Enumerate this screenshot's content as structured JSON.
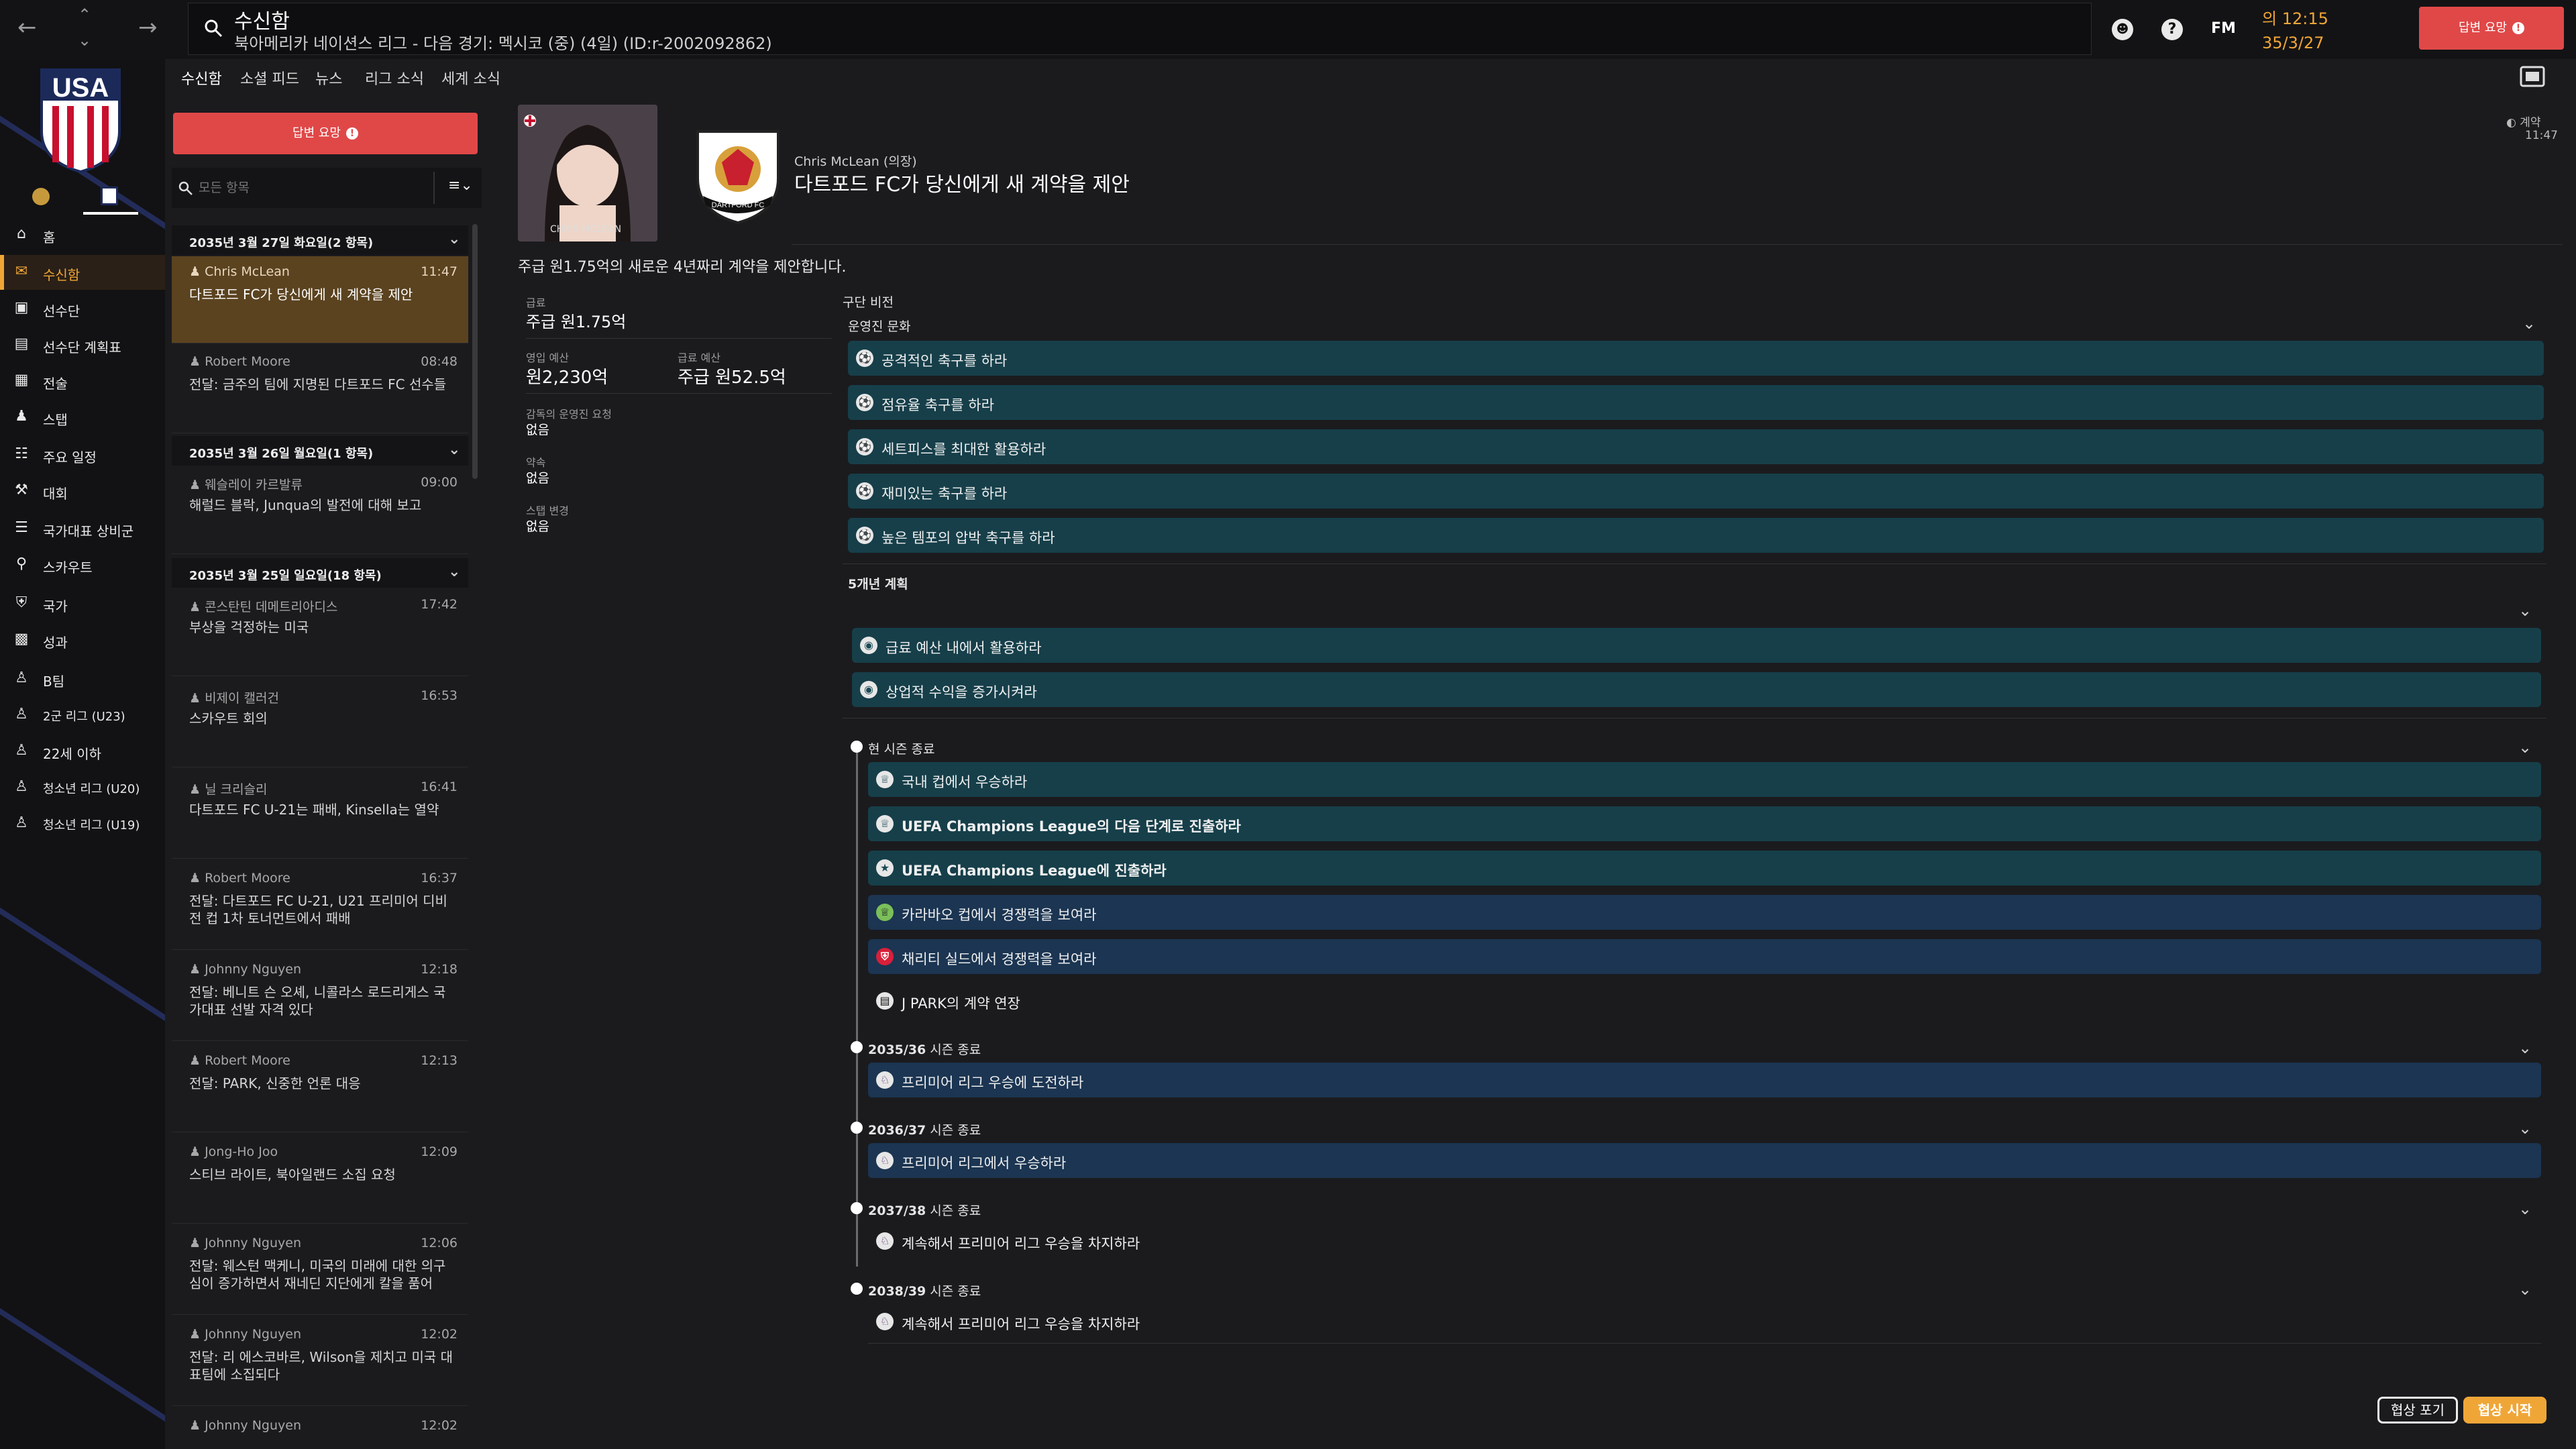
{
  "topbar": {
    "title": "수신함",
    "subtitle": "북아메리카 네이션스 리그 - 다음 경기: 멕시코 (중) (4일) (ID:r-2002092862)",
    "fm_label": "FM",
    "time": "의 12:15",
    "date": "35/3/27",
    "action_label": "답변 요망"
  },
  "left_nav": {
    "logo_text": "USA",
    "items": [
      {
        "label": "홈",
        "icon": "home-icon"
      },
      {
        "label": "수신함",
        "icon": "inbox-icon"
      },
      {
        "label": "선수단",
        "icon": "shirt-icon"
      },
      {
        "label": "선수단 계획표",
        "icon": "clipboard-icon"
      },
      {
        "label": "전술",
        "icon": "tactics-board-icon"
      },
      {
        "label": "스탭",
        "icon": "staff-icon"
      },
      {
        "label": "주요 일정",
        "icon": "calendar-icon"
      },
      {
        "label": "대회",
        "icon": "trophy-icon"
      },
      {
        "label": "국가대표 상비군",
        "icon": "list-icon"
      },
      {
        "label": "스카우트",
        "icon": "magnifier-icon"
      },
      {
        "label": "국가",
        "icon": "shield-icon"
      },
      {
        "label": "성과",
        "icon": "briefcase-icon"
      },
      {
        "label": "B팀",
        "icon": "team-icon"
      },
      {
        "label": "2군 리그 (U23)",
        "icon": "team-icon"
      },
      {
        "label": "22세 이하",
        "icon": "team-icon"
      },
      {
        "label": "청소년 리그 (U20)",
        "icon": "team-icon"
      },
      {
        "label": "청소년 리그 (U19)",
        "icon": "team-icon"
      }
    ]
  },
  "subtabs": [
    "수신함",
    "소셜 피드",
    "뉴스",
    "리그 소식",
    "세계 소식"
  ],
  "message_list": {
    "reply_button": "답변 요망",
    "search_placeholder": "모든 항목",
    "groups": [
      {
        "header": "2035년 3월 27일 화요일(2 항목)",
        "messages": [
          {
            "sender": "Chris McLean",
            "time": "11:47",
            "subject": "다트포드 FC가 당신에게 새 계약을 제안",
            "selected": true
          },
          {
            "sender": "Robert Moore",
            "time": "08:48",
            "subject": "전달: 금주의 팀에 지명된 다트포드 FC 선수들"
          }
        ]
      },
      {
        "header": "2035년 3월 26일 월요일(1 항목)",
        "messages": [
          {
            "sender": "웨슬레이 카르발류",
            "time": "09:00",
            "subject": "해럴드 블락, Junqua의 발전에 대해 보고"
          }
        ]
      },
      {
        "header": "2035년 3월 25일 일요일(18 항목)",
        "messages": [
          {
            "sender": "콘스탄틴 데메트리아디스",
            "time": "17:42",
            "subject": "부상을 걱정하는 미국"
          },
          {
            "sender": "비제이 캘러건",
            "time": "16:53",
            "subject": "스카우트 회의"
          },
          {
            "sender": "닐 크리슬리",
            "time": "16:41",
            "subject": "다트포드 FC U-21는 패배, Kinsella는 열약"
          },
          {
            "sender": "Robert Moore",
            "time": "16:37",
            "subject": "전달: 다트포드 FC U-21, U21 프리미어 디비전 컵 1차 토너먼트에서 패배"
          },
          {
            "sender": "Johnny Nguyen",
            "time": "12:18",
            "subject": "전달: 베니트 슨 오셰, 니콜라스 로드리게스 국가대표 선발 자격 있다"
          },
          {
            "sender": "Robert Moore",
            "time": "12:13",
            "subject": "전달: PARK, 신중한 언론 대응"
          },
          {
            "sender": "Jong-Ho Joo",
            "time": "12:09",
            "subject": "스티브 라이트, 북아일랜드 소집 요청"
          },
          {
            "sender": "Johnny Nguyen",
            "time": "12:06",
            "subject": "전달: 웨스턴 맥케니, 미국의 미래에 대한 의구심이 증가하면서 재네딘 지단에게 칼을 품어"
          },
          {
            "sender": "Johnny Nguyen",
            "time": "12:02",
            "subject": "전달: 리 에스코바르, Wilson을 제치고 미국 대표팀에 소집되다"
          },
          {
            "sender": "Johnny Nguyen",
            "time": "12:02",
            "subject": ""
          }
        ]
      }
    ]
  },
  "detail": {
    "avatar_caption": "CHRIS MCLEAN",
    "club_badge_text": "DARTFORD FC",
    "sender_line": "Chris McLean (의장)",
    "headline": "다트포드 FC가 당신에게 새 계약을 제안",
    "status_label": "계약",
    "status_time": "11:47",
    "intro": "주급 원1.75억의 새로운 4년짜리 계약을 제안합니다.",
    "fields": {
      "salary_label": "급료",
      "salary_value": "주급 원1.75억",
      "transfer_budget_label": "영입 예산",
      "transfer_budget_value": "원2,230억",
      "wage_budget_label": "급료 예산",
      "wage_budget_value": "주급 원52.5억",
      "requests_label": "감독의 운영진 요청",
      "requests_value": "없음",
      "promise_label": "약속",
      "promise_value": "없음",
      "staff_change_label": "스탭 변경",
      "staff_change_value": "없음"
    },
    "vision_label": "구단 비전",
    "culture_label": "운영진 문화",
    "culture_items": [
      "공격적인 축구를 하라",
      "점유율 축구를 하라",
      "세트피스를 최대한 활용하라",
      "재미있는 축구를 하라",
      "높은 템포의 압박 축구를 하라"
    ],
    "plan_label": "5개년 계획",
    "plan_items": [
      "급료 예산 내에서 활용하라",
      "상업적 수익을 증가시켜라"
    ],
    "timeline": [
      {
        "head_bold": "",
        "head_rest": "현 시즌 종료",
        "items": [
          {
            "text": "국내 컵에서 우승하라",
            "style": "teal"
          },
          {
            "text": "UEFA Champions League의 다음 단계로 진출하라",
            "style": "teal"
          },
          {
            "text": "UEFA Champions League에 진출하라",
            "style": "teal"
          },
          {
            "text": "카라바오 컵에서 경쟁력을 보여라",
            "style": "navy"
          },
          {
            "text": "채리티 실드에서 경쟁력을 보여라",
            "style": "navy"
          },
          {
            "text": "J PARK의 계약 연장",
            "style": "plain"
          }
        ]
      },
      {
        "head_bold": "2035/36",
        "head_rest": " 시즌 종료",
        "items": [
          {
            "text": "프리미어 리그 우승에 도전하라",
            "style": "navy"
          }
        ]
      },
      {
        "head_bold": "2036/37",
        "head_rest": " 시즌 종료",
        "items": [
          {
            "text": "프리미어 리그에서 우승하라",
            "style": "navy"
          }
        ]
      },
      {
        "head_bold": "2037/38",
        "head_rest": " 시즌 종료",
        "items": [
          {
            "text": "계속해서 프리미어 리그 우승을 차지하라",
            "style": "plain"
          }
        ]
      },
      {
        "head_bold": "2038/39",
        "head_rest": " 시즌 종료",
        "items": [
          {
            "text": "계속해서 프리미어 리그 우승을 차지하라",
            "style": "plain"
          }
        ]
      }
    ],
    "reject_label": "협상 포기",
    "accept_label": "협상 시작"
  },
  "colors": {
    "accent": "#f0a637",
    "alert": "#e04848",
    "teal_row": "#163f4a",
    "navy_row": "#1b3552"
  }
}
